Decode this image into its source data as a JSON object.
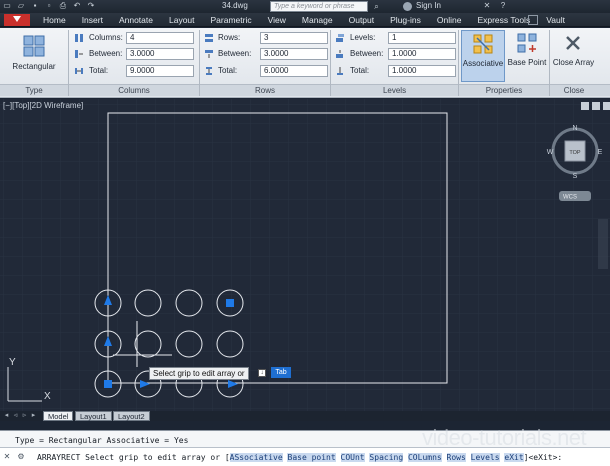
{
  "titlebar": {
    "doc_name": "34.dwg",
    "search_placeholder": "Type a keyword or phrase",
    "sign_in": "Sign In"
  },
  "tabs": [
    "Home",
    "Insert",
    "Annotate",
    "Layout",
    "Parametric",
    "View",
    "Manage",
    "Output",
    "Plug-ins",
    "Online",
    "Express Tools",
    "Vault"
  ],
  "ribbon": {
    "type_panel": {
      "button_label": "Rectangular",
      "panel_title": "Type"
    },
    "columns_panel": {
      "panel_title": "Columns",
      "columns_label": "Columns:",
      "columns_value": "4",
      "between_label": "Between:",
      "between_value": "3.0000",
      "total_label": "Total:",
      "total_value": "9.0000"
    },
    "rows_panel": {
      "panel_title": "Rows",
      "rows_label": "Rows:",
      "rows_value": "3",
      "between_label": "Between:",
      "between_value": "3.0000",
      "total_label": "Total:",
      "total_value": "6.0000"
    },
    "levels_panel": {
      "panel_title": "Levels",
      "levels_label": "Levels:",
      "levels_value": "1",
      "between_label": "Between:",
      "between_value": "1.0000",
      "total_label": "Total:",
      "total_value": "1.0000"
    },
    "properties_panel": {
      "panel_title": "Properties",
      "associative_label": "Associative",
      "basepoint_label": "Base Point"
    },
    "close_panel": {
      "panel_title": "Close",
      "close_label": "Close Array"
    }
  },
  "viewport": {
    "label": "[−][Top][2D Wireframe]",
    "viewcube": {
      "face": "TOP",
      "n": "N",
      "s": "S",
      "e": "E",
      "w": "W",
      "wcs": "WCS"
    },
    "ucs_x": "X",
    "ucs_y": "Y",
    "tooltip": "Select grip to edit array or",
    "tooltip_small": "↓",
    "tooltip_input": "Tab"
  },
  "layout_tabs": [
    "Model",
    "Layout1",
    "Layout2"
  ],
  "command": {
    "history": "Type = Rectangular  Associative = Yes",
    "prompt_prefix": "ARRAYRECT Select grip to edit array or [",
    "options": [
      {
        "key": "AS",
        "rest": "sociative"
      },
      {
        "key": "B",
        "rest": "ase point"
      },
      {
        "key": "COU",
        "rest": "nt"
      },
      {
        "key": "S",
        "rest": "pacing"
      },
      {
        "key": "COL",
        "rest": "umns"
      },
      {
        "key": "R",
        "rest": "ows"
      },
      {
        "key": "L",
        "rest": "evels"
      },
      {
        "key": "eX",
        "rest": "it"
      }
    ],
    "prompt_suffix": "]<eXit>:"
  },
  "watermark": "video-tutorials.net",
  "colors": {
    "viewport_bg": "#212938",
    "grip_blue": "#1f7ae8",
    "ribbon_bg": "#e8ecf0"
  }
}
